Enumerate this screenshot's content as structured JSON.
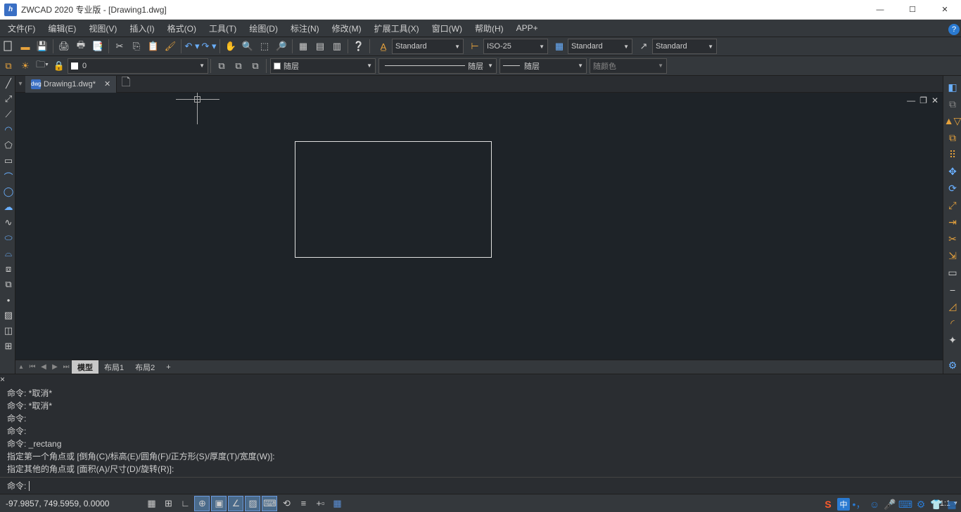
{
  "title": "ZWCAD 2020 专业版 - [Drawing1.dwg]",
  "menus": [
    "文件(F)",
    "编辑(E)",
    "视图(V)",
    "插入(I)",
    "格式(O)",
    "工具(T)",
    "绘图(D)",
    "标注(N)",
    "修改(M)",
    "扩展工具(X)",
    "窗口(W)",
    "帮助(H)",
    "APP+"
  ],
  "styles": {
    "text_style": "Standard",
    "dim_style": "ISO-25",
    "table_style": "Standard",
    "mleader_style": "Standard"
  },
  "layer": {
    "current": "0"
  },
  "props": {
    "color": "随层",
    "linetype": "随层",
    "lineweight": "随层",
    "plotstyle": "随颜色"
  },
  "doc_tab": "Drawing1.dwg*",
  "layout_tabs": {
    "active": "模型",
    "tabs": [
      "模型",
      "布局1",
      "布局2"
    ]
  },
  "cmd_history": "命令: *取消*\n命令: *取消*\n命令:\n命令:\n命令: _rectang\n指定第一个角点或 [倒角(C)/标高(E)/圆角(F)/正方形(S)/厚度(T)/宽度(W)]:\n指定其他的角点或 [面积(A)/尺寸(D)/旋转(R)]:",
  "cmd_prompt": "命令:",
  "status": {
    "coords": "-97.9857, 749.5959, 0.0000",
    "scale": "1:1"
  },
  "tray": {
    "ime": "中",
    "sogou": "S"
  }
}
